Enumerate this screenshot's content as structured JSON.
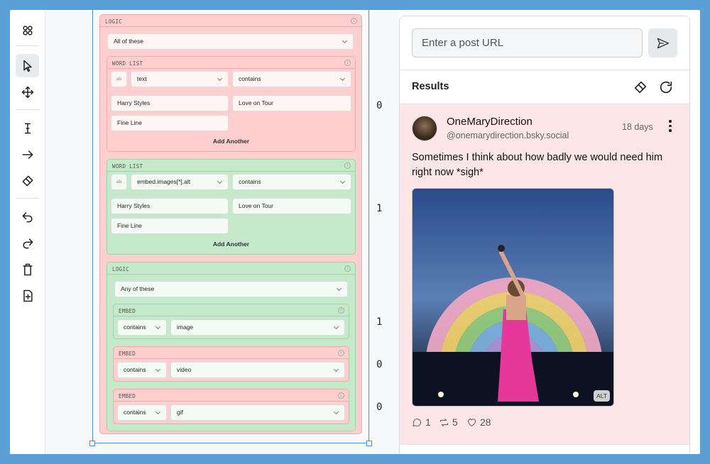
{
  "builder": {
    "root_label": "LOGIC",
    "root_select": "All of these",
    "word_list_1": {
      "label": "WORD LIST",
      "toggle": "ab",
      "field": "text",
      "op": "contains",
      "words": [
        "Harry Styles",
        "Love on Tour",
        "Fine Line"
      ],
      "add": "Add Another"
    },
    "word_list_2": {
      "label": "WORD LIST",
      "toggle": "ab",
      "field": "embed.images[*].alt",
      "op": "contains",
      "words": [
        "Harry Styles",
        "Love on Tour",
        "Fine Line"
      ],
      "add": "Add Another"
    },
    "logic_2": {
      "label": "LOGIC",
      "select": "Any of these"
    },
    "embeds": [
      {
        "label": "EMBED",
        "op": "contains",
        "value": "image"
      },
      {
        "label": "EMBED",
        "op": "contains",
        "value": "video"
      },
      {
        "label": "EMBED",
        "op": "contains",
        "value": "gif"
      }
    ],
    "counts": [
      "0",
      "1",
      "1",
      "0",
      "0"
    ]
  },
  "panel": {
    "url_placeholder": "Enter a post URL",
    "results_label": "Results",
    "post": {
      "display_name": "OneMaryDirection",
      "handle": "@onemarydirection.bsky.social",
      "time": "18 days",
      "text": "Sometimes I think about how badly we would need him right now *sigh*",
      "alt_badge": "ALT",
      "replies": "1",
      "reposts": "5",
      "likes": "28"
    }
  },
  "colors": {
    "match_green": "#c5e9cb",
    "nomatch_red": "#ffcfcf",
    "result_bg": "#fde6e8",
    "selection": "#4a8fe0"
  }
}
